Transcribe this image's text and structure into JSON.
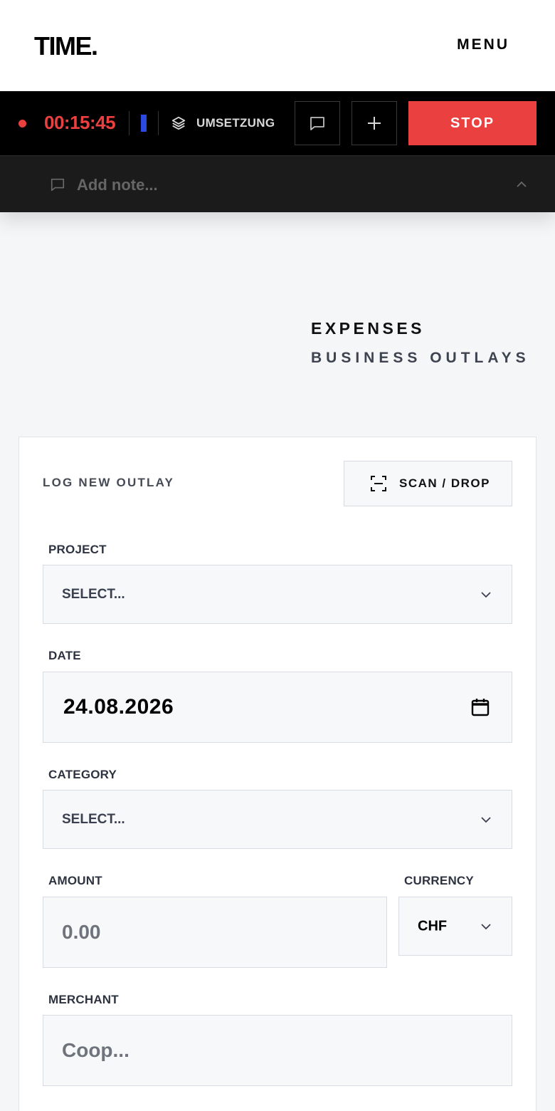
{
  "header": {
    "logo": "TIME.",
    "menu_label": "MENU"
  },
  "timer": {
    "elapsed": "00:15:45",
    "project_color": "#2c49e0",
    "phase": "UMSETZUNG",
    "stop_label": "STOP"
  },
  "note": {
    "placeholder": "Add note..."
  },
  "page": {
    "title": "EXPENSES",
    "subtitle": "BUSINESS OUTLAYS"
  },
  "form": {
    "heading": "LOG NEW OUTLAY",
    "scan_label": "SCAN / DROP",
    "project": {
      "label": "PROJECT",
      "value": "SELECT..."
    },
    "date": {
      "label": "DATE",
      "value": "24.08.2026"
    },
    "category": {
      "label": "CATEGORY",
      "value": "SELECT..."
    },
    "amount": {
      "label": "AMOUNT",
      "placeholder": "0.00"
    },
    "currency": {
      "label": "CURRENCY",
      "value": "CHF"
    },
    "merchant": {
      "label": "MERCHANT",
      "placeholder": "Coop..."
    }
  },
  "colors": {
    "accent_red": "#ea4040",
    "dark": "#000000"
  }
}
